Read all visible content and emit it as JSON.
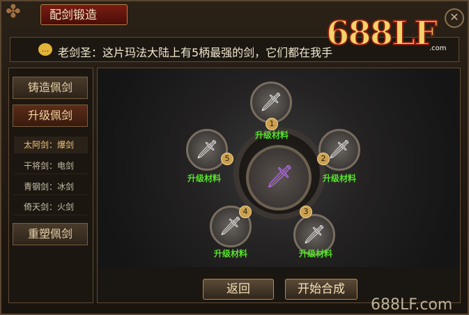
{
  "window": {
    "title": "配剑锻造",
    "close_icon": "close-icon"
  },
  "message": {
    "text": "老剑圣：这片玛法大陆上有5柄最强的剑，它们都在我手"
  },
  "logo": {
    "text": "688LF",
    "sub": ".com"
  },
  "sidebar": {
    "buttons": [
      {
        "label": "铸造佩剑",
        "active": false
      },
      {
        "label": "升级佩剑",
        "active": true
      },
      {
        "label": "重塑佩剑",
        "active": false
      }
    ],
    "sub_items": [
      {
        "label": "太阿剑：爆剑",
        "active": true
      },
      {
        "label": "干将剑：电剑",
        "active": false
      },
      {
        "label": "青钢剑：冰剑",
        "active": false
      },
      {
        "label": "倚天剑：火剑",
        "active": false
      }
    ]
  },
  "forge": {
    "slots": [
      {
        "num": "1",
        "label": "升级材料"
      },
      {
        "num": "2",
        "label": "升级材料"
      },
      {
        "num": "3",
        "label": "升级材料"
      },
      {
        "num": "4",
        "label": "升级材料"
      },
      {
        "num": "5",
        "label": "升级材料"
      }
    ]
  },
  "actions": {
    "back": "返回",
    "start": "开始合成"
  },
  "watermark": "688LF.com",
  "colors": {
    "material_label": "#56e32a",
    "title_tab": "#7a1c12"
  }
}
